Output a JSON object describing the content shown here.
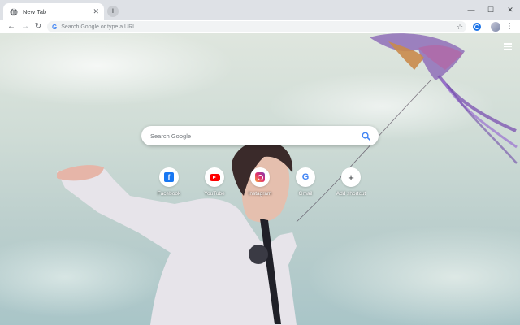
{
  "window": {
    "tab": {
      "title": "New Tab",
      "favicon": "globe-icon",
      "close_glyph": "✕"
    },
    "new_tab_glyph": "+",
    "controls": {
      "minimize": "—",
      "maximize": "☐",
      "close": "✕"
    }
  },
  "toolbar": {
    "back": "←",
    "forward": "→",
    "reload": "↻",
    "omnibox_g": "G",
    "omnibox_placeholder": "Search Google or type a URL",
    "star": "☆",
    "menu": "⋮"
  },
  "ntp": {
    "search_placeholder": "Search Google",
    "shortcuts": [
      {
        "label": "Facebook",
        "icon": "facebook-icon",
        "glyph": "f"
      },
      {
        "label": "YouTube",
        "icon": "youtube-icon",
        "glyph": ""
      },
      {
        "label": "Instagram",
        "icon": "instagram-icon",
        "glyph": ""
      },
      {
        "label": "Gmail",
        "icon": "google-icon",
        "glyph": "G"
      },
      {
        "label": "Add shortcut",
        "icon": "plus-icon",
        "glyph": "+"
      }
    ]
  },
  "colors": {
    "accent": "#1a73e8",
    "tabstrip": "#dee1e6",
    "facebook": "#1877f2",
    "youtube": "#ff0000"
  }
}
